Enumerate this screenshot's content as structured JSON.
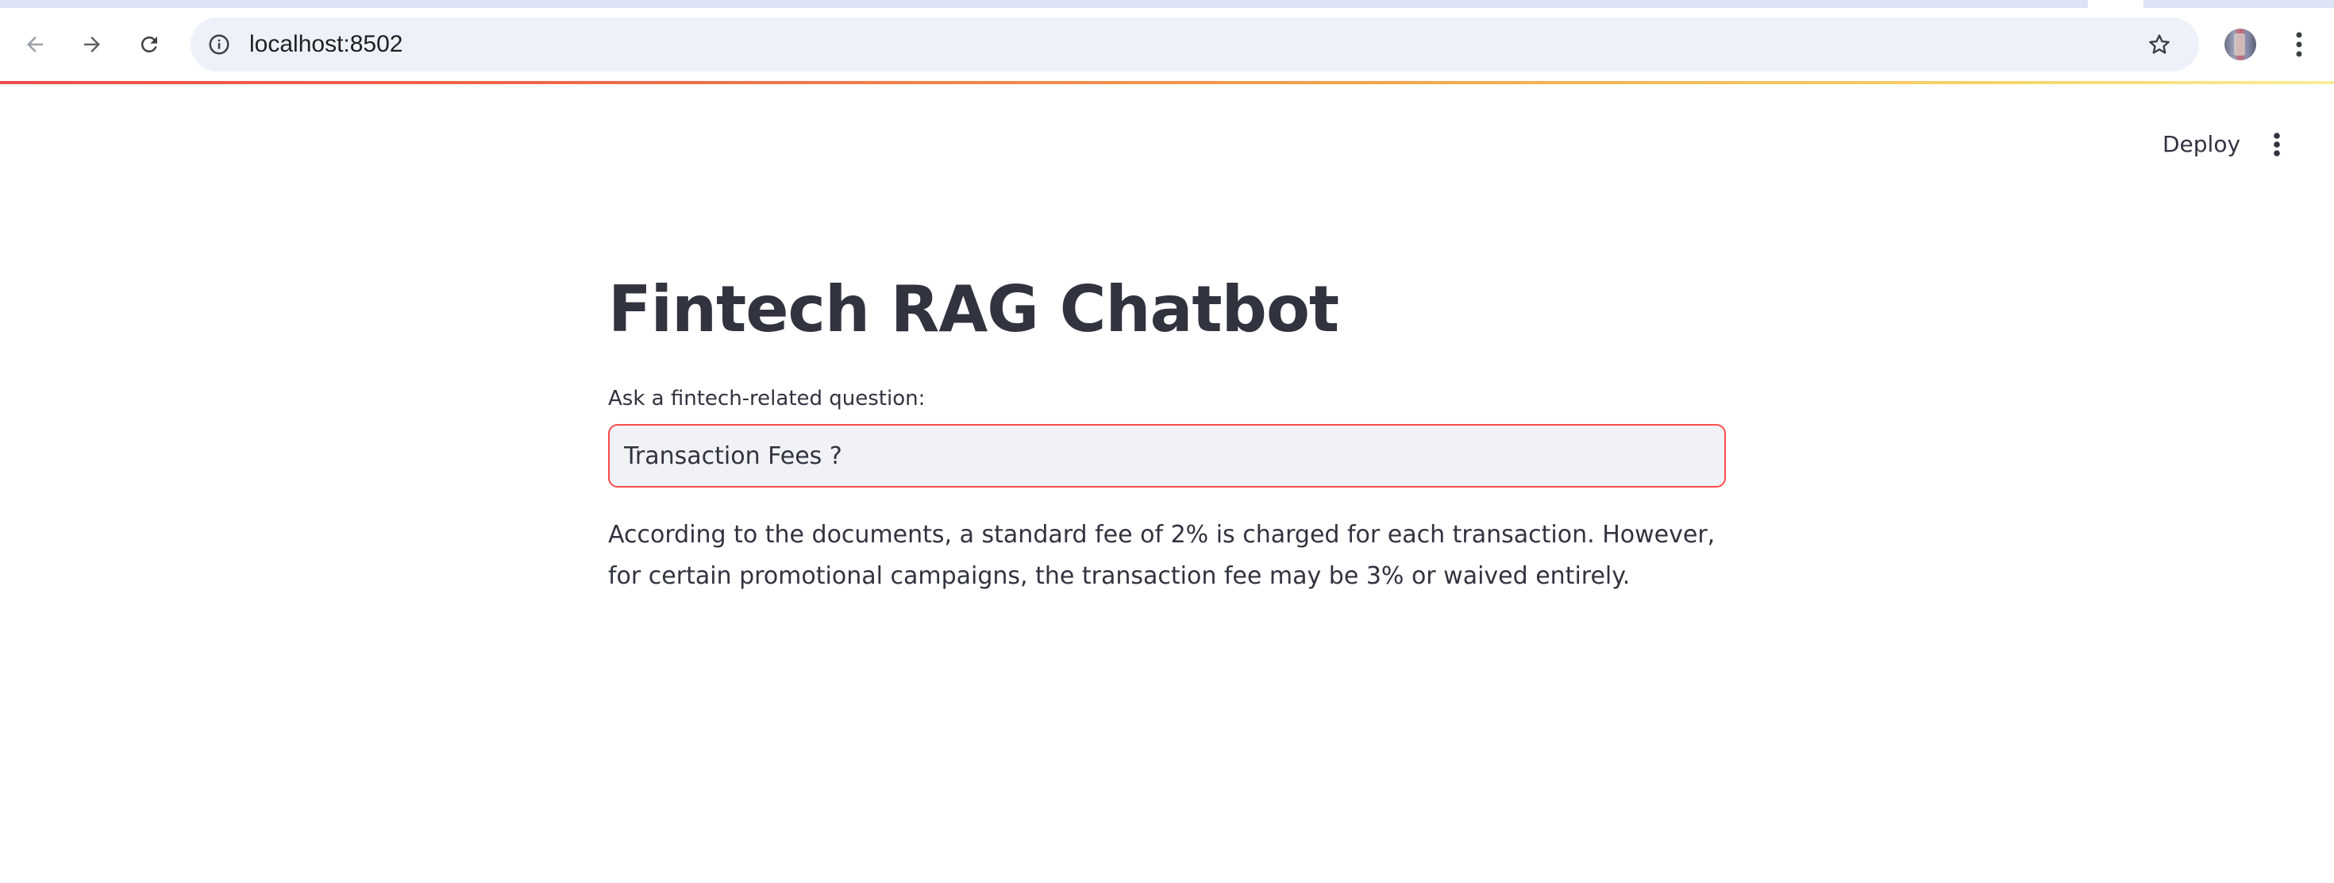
{
  "browser": {
    "url": "localhost:8502",
    "icons": {
      "back": "arrow-left-icon",
      "forward": "arrow-right-icon",
      "reload": "reload-icon",
      "site_info": "info-icon",
      "bookmark": "star-icon",
      "profile": "avatar",
      "menu": "vertical-dots-icon"
    }
  },
  "app": {
    "deploy_label": "Deploy",
    "menu_icon": "vertical-dots-icon",
    "accent_color": "#ff4b4b"
  },
  "main": {
    "title": "Fintech RAG Chatbot",
    "input_label": "Ask a fintech-related question:",
    "input_value": "Transaction Fees ?",
    "answer": "According to the documents, a standard fee of 2% is charged for each transaction. However, for certain promotional campaigns, the transaction fee may be 3% or waived entirely."
  }
}
